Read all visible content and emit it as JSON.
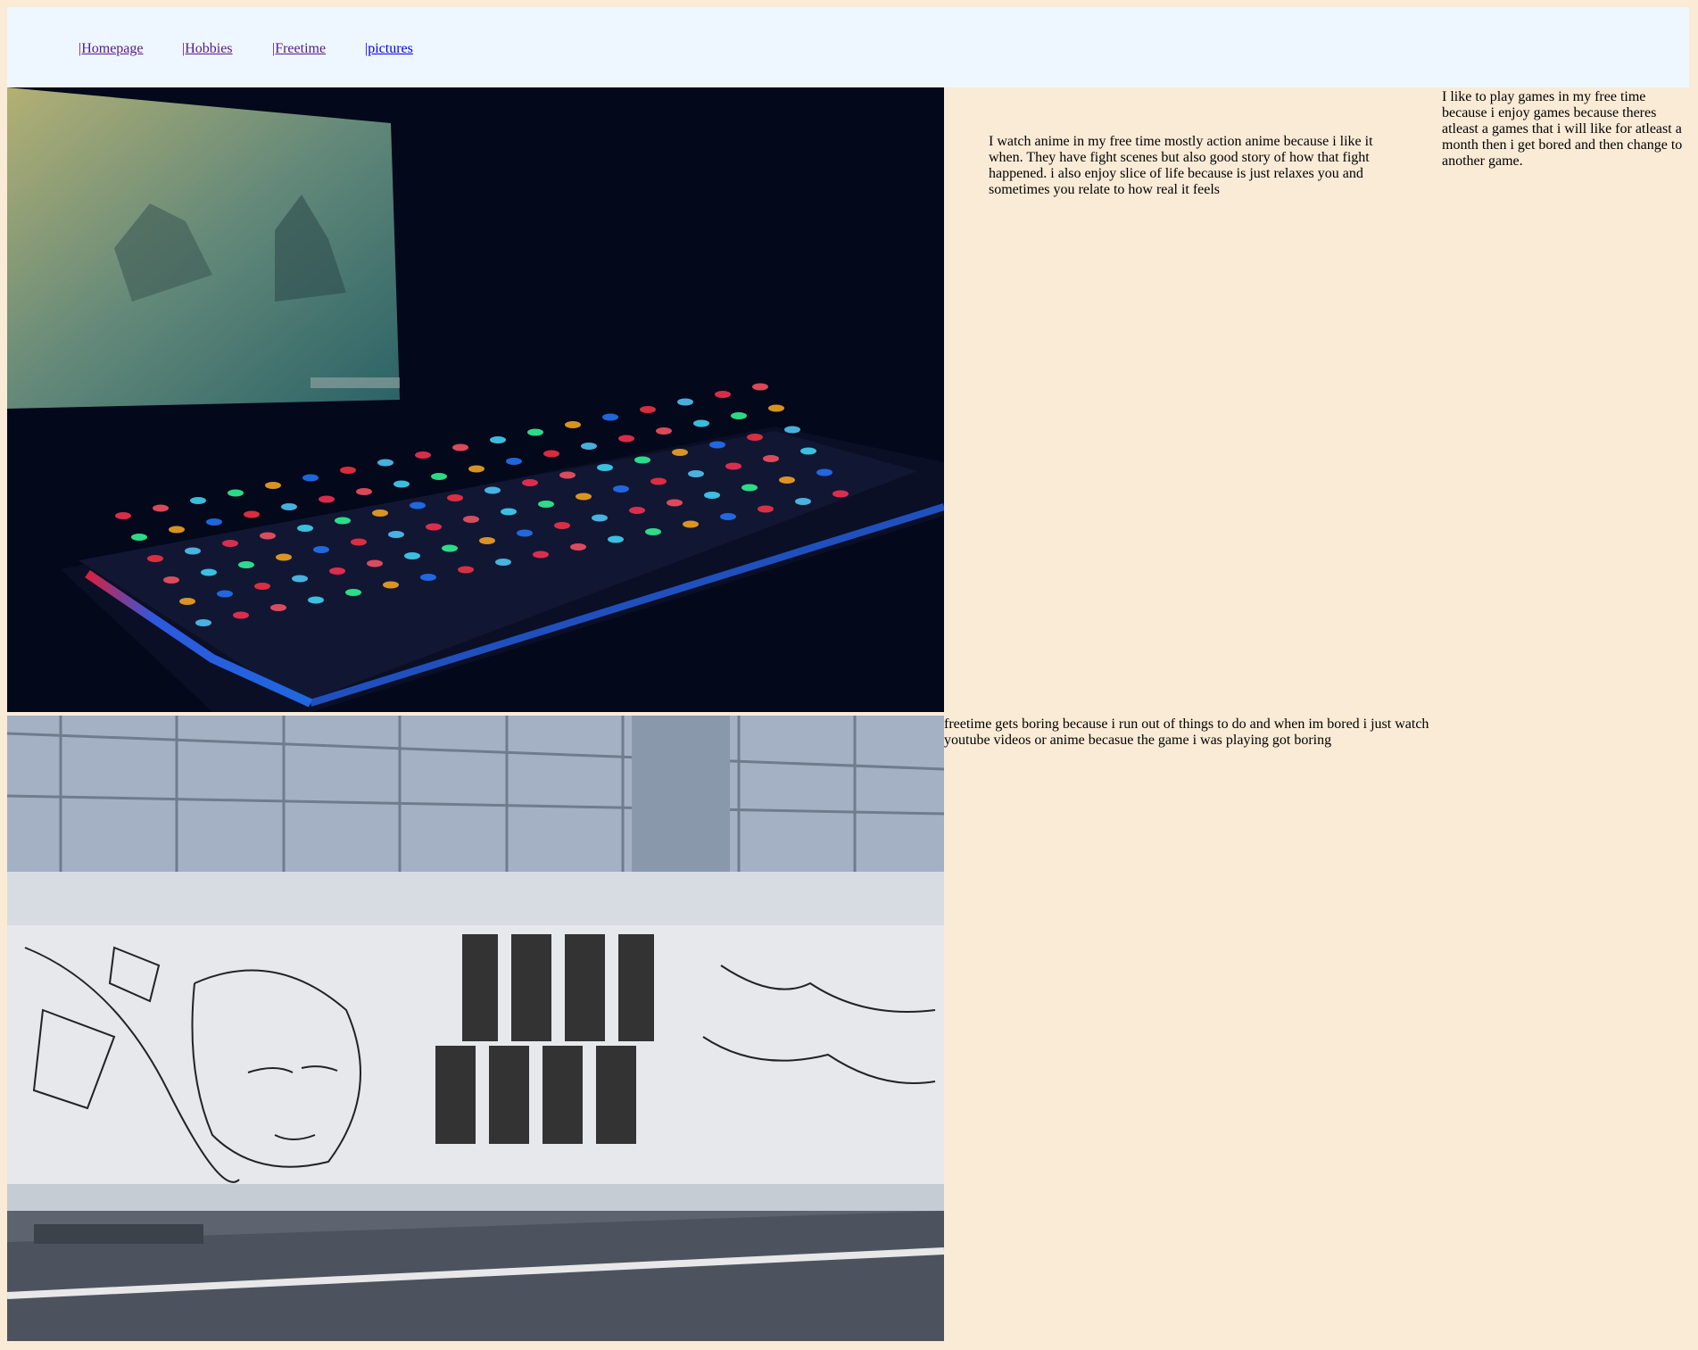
{
  "nav": {
    "items": [
      {
        "label": "|Homepage",
        "state": "visited"
      },
      {
        "label": "|Hobbies",
        "state": "visited"
      },
      {
        "label": "|Freetime",
        "state": "visited"
      },
      {
        "label": "|pictures",
        "state": "unvisited"
      }
    ]
  },
  "colors": {
    "page_background": "#faebd7",
    "nav_background": "#eef7ff",
    "link_visited": "#551a8b",
    "link_unvisited": "#0000ee"
  },
  "content": {
    "anime_text": "I watch anime in my free time mostly action anime because i like it when. They have fight scenes but also good story of how that fight happened. i also enjoy slice of life because is just relaxes you and sometimes you relate to how real it feels",
    "games_text": "I like to play games in my free time because i enjoy games because theres atleast a games that i will like for atleast a month then i get bored and then change to another game.",
    "freetime_text": "freetime gets boring because i run out of things to do and when im bored i just watch youtube videos or anime becasue the game i was playing got boring"
  },
  "images": {
    "gaming_photo": {
      "icon": "keyboard-photo"
    },
    "mural_photo": {
      "icon": "manga-mural-photo"
    }
  }
}
